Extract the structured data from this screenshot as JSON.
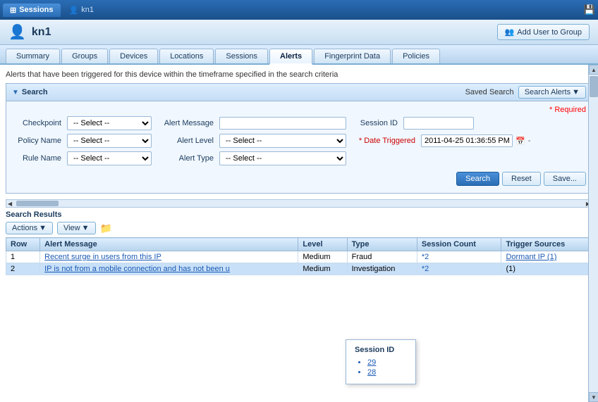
{
  "titleBar": {
    "activeTab": "Sessions",
    "inactiveTab": "kn1",
    "activeTabIcon": "grid-icon",
    "inactiveTabIcon": "user-icon"
  },
  "header": {
    "userIcon": "👤",
    "title": "kn1",
    "addUserBtn": "Add User to Group"
  },
  "navTabs": [
    {
      "label": "Summary",
      "active": false
    },
    {
      "label": "Groups",
      "active": false
    },
    {
      "label": "Devices",
      "active": false
    },
    {
      "label": "Locations",
      "active": false
    },
    {
      "label": "Sessions",
      "active": false
    },
    {
      "label": "Alerts",
      "active": true
    },
    {
      "label": "Fingerprint Data",
      "active": false
    },
    {
      "label": "Policies",
      "active": false
    }
  ],
  "infoText": "Alerts that have been triggered for this device within the timeframe specified in the search criteria",
  "search": {
    "title": "Search",
    "savedSearchLabel": "Saved Search",
    "searchAlertsBtn": "Search Alerts",
    "requiredNote": "* Required",
    "fields": {
      "checkpoint": {
        "label": "Checkpoint",
        "value": "-- Select --"
      },
      "alertMessage": {
        "label": "Alert Message",
        "value": ""
      },
      "sessionId": {
        "label": "Session ID",
        "value": ""
      },
      "policyName": {
        "label": "Policy Name",
        "value": "-- Select --"
      },
      "alertLevel": {
        "label": "Alert Level",
        "value": "-- Select --"
      },
      "dateTriggered": {
        "label": "* Date Triggered",
        "value": "2011-04-25 01:36:55 PM"
      },
      "ruleName": {
        "label": "Rule Name",
        "value": "-- Select --"
      },
      "alertType": {
        "label": "Alert Type",
        "value": "-- Select --"
      }
    },
    "buttons": {
      "search": "Search",
      "reset": "Reset",
      "save": "Save..."
    }
  },
  "results": {
    "title": "Search Results",
    "toolbar": {
      "actions": "Actions",
      "view": "View"
    },
    "columns": [
      "Row",
      "Alert Message",
      "Level",
      "Type",
      "Session Count",
      "Trigger Sources"
    ],
    "rows": [
      {
        "row": "1",
        "alertMessage": "Recent surge in users from this IP",
        "level": "Medium",
        "type": "Fraud",
        "sessionCount": "*2",
        "triggerSources": "Dormant IP (1)"
      },
      {
        "row": "2",
        "alertMessage": "IP is not from a mobile connection and has not been u",
        "level": "Medium",
        "type": "Investigation",
        "sessionCount": "*2",
        "triggerSources": "(1)"
      }
    ]
  },
  "tooltip": {
    "title": "Session ID",
    "items": [
      "29",
      "28"
    ]
  }
}
